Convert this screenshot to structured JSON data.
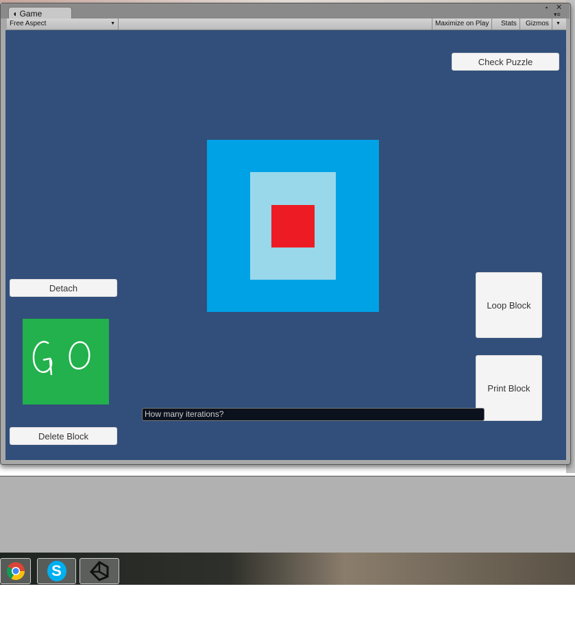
{
  "window": {
    "tab_label": "Game",
    "tab_icon": "unity-game-icon"
  },
  "toolbar": {
    "aspect": "Free Aspect",
    "maximize": "Maximize on Play",
    "stats": "Stats",
    "gizmos": "Gizmos"
  },
  "game": {
    "check_puzzle": "Check Puzzle",
    "detach": "Detach",
    "delete_block": "Delete Block",
    "loop_block": "Loop Block",
    "print_block": "Print Block",
    "go_block_text": "GO",
    "iterations_input": "How many iterations?",
    "colors": {
      "background": "#314f7a",
      "outer": "#00a2e6",
      "inner": "#99d8ea",
      "center": "#ed1c24",
      "go": "#22b14c"
    }
  },
  "taskbar": {
    "apps": [
      "chrome-icon",
      "skype-icon",
      "unity-icon"
    ]
  }
}
